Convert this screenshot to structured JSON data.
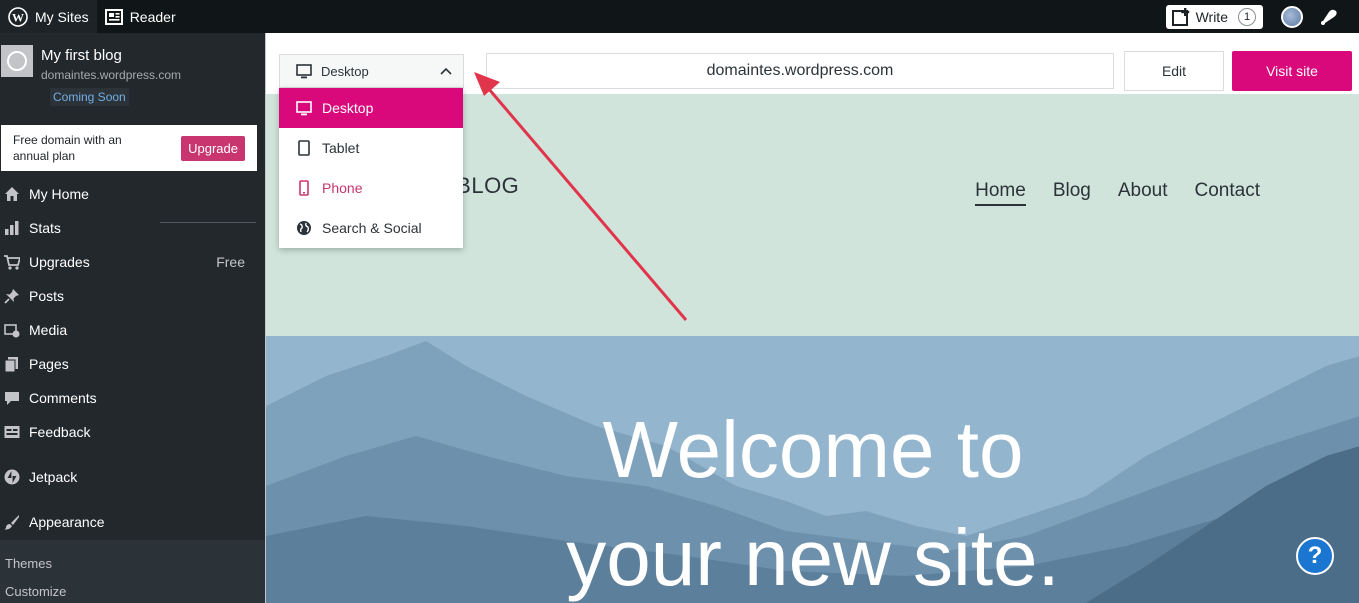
{
  "masterbar": {
    "my_sites": "My Sites",
    "reader": "Reader",
    "write": "Write",
    "write_count": "1"
  },
  "sidebar": {
    "site_title": "My first blog",
    "site_domain": "domaintes.wordpress.com",
    "coming_soon": "Coming Soon",
    "upgrade_text": "Free domain with an annual plan",
    "upgrade_button": "Upgrade",
    "items": [
      {
        "label": "My Home",
        "icon": "home-icon"
      },
      {
        "label": "Stats",
        "icon": "stats-icon"
      },
      {
        "label": "Upgrades",
        "icon": "cart-icon",
        "badge": "Free"
      },
      {
        "label": "Posts",
        "icon": "pin-icon"
      },
      {
        "label": "Media",
        "icon": "media-icon"
      },
      {
        "label": "Pages",
        "icon": "pages-icon"
      },
      {
        "label": "Comments",
        "icon": "comment-icon"
      },
      {
        "label": "Feedback",
        "icon": "feedback-icon"
      },
      {
        "label": "Jetpack",
        "icon": "jetpack-icon"
      },
      {
        "label": "Appearance",
        "icon": "brush-icon"
      }
    ],
    "subitems": [
      "Themes",
      "Customize"
    ]
  },
  "toolbar": {
    "device_label": "Desktop",
    "url": "domaintes.wordpress.com",
    "edit_label": "Edit",
    "visit_label": "Visit site"
  },
  "device_menu": {
    "options": [
      "Desktop",
      "Tablet",
      "Phone",
      "Search & Social"
    ],
    "selected": "Desktop"
  },
  "preview": {
    "blog_title_visible": "T BLOG",
    "nav": [
      "Home",
      "Blog",
      "About",
      "Contact"
    ],
    "hero_line1": "Welcome to",
    "hero_line2": "your new site."
  },
  "colors": {
    "accent": "#d9087b",
    "masterbar": "#101517",
    "sidebar": "#23282d",
    "header_bg": "#d0e4dc",
    "arrow": "#e0354a"
  }
}
